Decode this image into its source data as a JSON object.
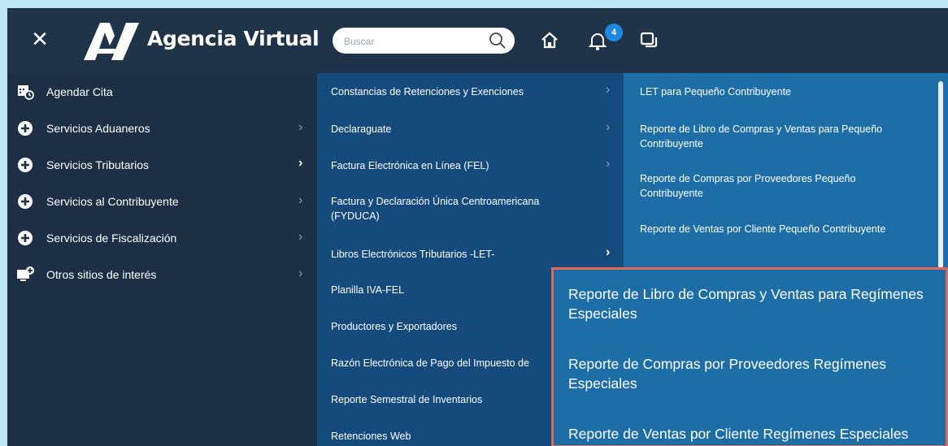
{
  "header": {
    "brand": "Agencia Virtual",
    "search_placeholder": "Buscar",
    "notification_count": "4"
  },
  "sidebar": {
    "items": [
      {
        "label": "Agendar Cita",
        "icon": "calendar-clock-icon",
        "has_submenu": false
      },
      {
        "label": "Servicios Aduaneros",
        "icon": "plus-circle-icon",
        "has_submenu": true
      },
      {
        "label": "Servicios Tributarios",
        "icon": "plus-circle-icon",
        "has_submenu": true,
        "active": true
      },
      {
        "label": "Servicios al Contribuyente",
        "icon": "plus-circle-icon",
        "has_submenu": true
      },
      {
        "label": "Servicios de Fiscalización",
        "icon": "plus-circle-icon",
        "has_submenu": true
      },
      {
        "label": "Otros sitios de interés",
        "icon": "monitor-plus-icon",
        "has_submenu": true
      }
    ]
  },
  "submenu": {
    "items": [
      {
        "label": "Constancias de Retenciones y Exenciones"
      },
      {
        "label": "Declaraguate"
      },
      {
        "label": "Factura Electrónica en Línea (FEL)"
      },
      {
        "label": "Factura y Declaración Única Centroamericana (FYDUCA)"
      },
      {
        "label": "Libros Electrónicos Tributarios -LET-"
      },
      {
        "label": "Planilla IVA-FEL"
      },
      {
        "label": "Productores y Exportadores"
      },
      {
        "label": "Razón Electrónica de Pago del Impuesto de"
      },
      {
        "label": "Reporte Semestral de Inventarios"
      },
      {
        "label": "Retenciones Web"
      }
    ]
  },
  "third_menu": {
    "items": [
      {
        "label": "LET para Pequeño Contribuyente"
      },
      {
        "label": "Reporte de Libro de Compras y Ventas para Pequeño Contribuyente"
      },
      {
        "label": "Reporte de Compras por Proveedores Pequeño Contribuyente"
      },
      {
        "label": "Reporte de Ventas por Cliente Pequeño Contribuyente"
      }
    ],
    "highlighted": [
      {
        "label": "Reporte de Libro de Compras y Ventas para Regímenes Especiales"
      },
      {
        "label": "Reporte de Compras por Proveedores Regímenes Especiales"
      },
      {
        "label": "Reporte de Ventas por Cliente Regímenes Especiales"
      }
    ]
  },
  "colors": {
    "topbar": "#1f3349",
    "sidebar": "#1c2f44",
    "submenu": "#154a7c",
    "third_menu": "#1d6ea6",
    "highlight_border": "#e06a56",
    "badge": "#1e88e5"
  }
}
